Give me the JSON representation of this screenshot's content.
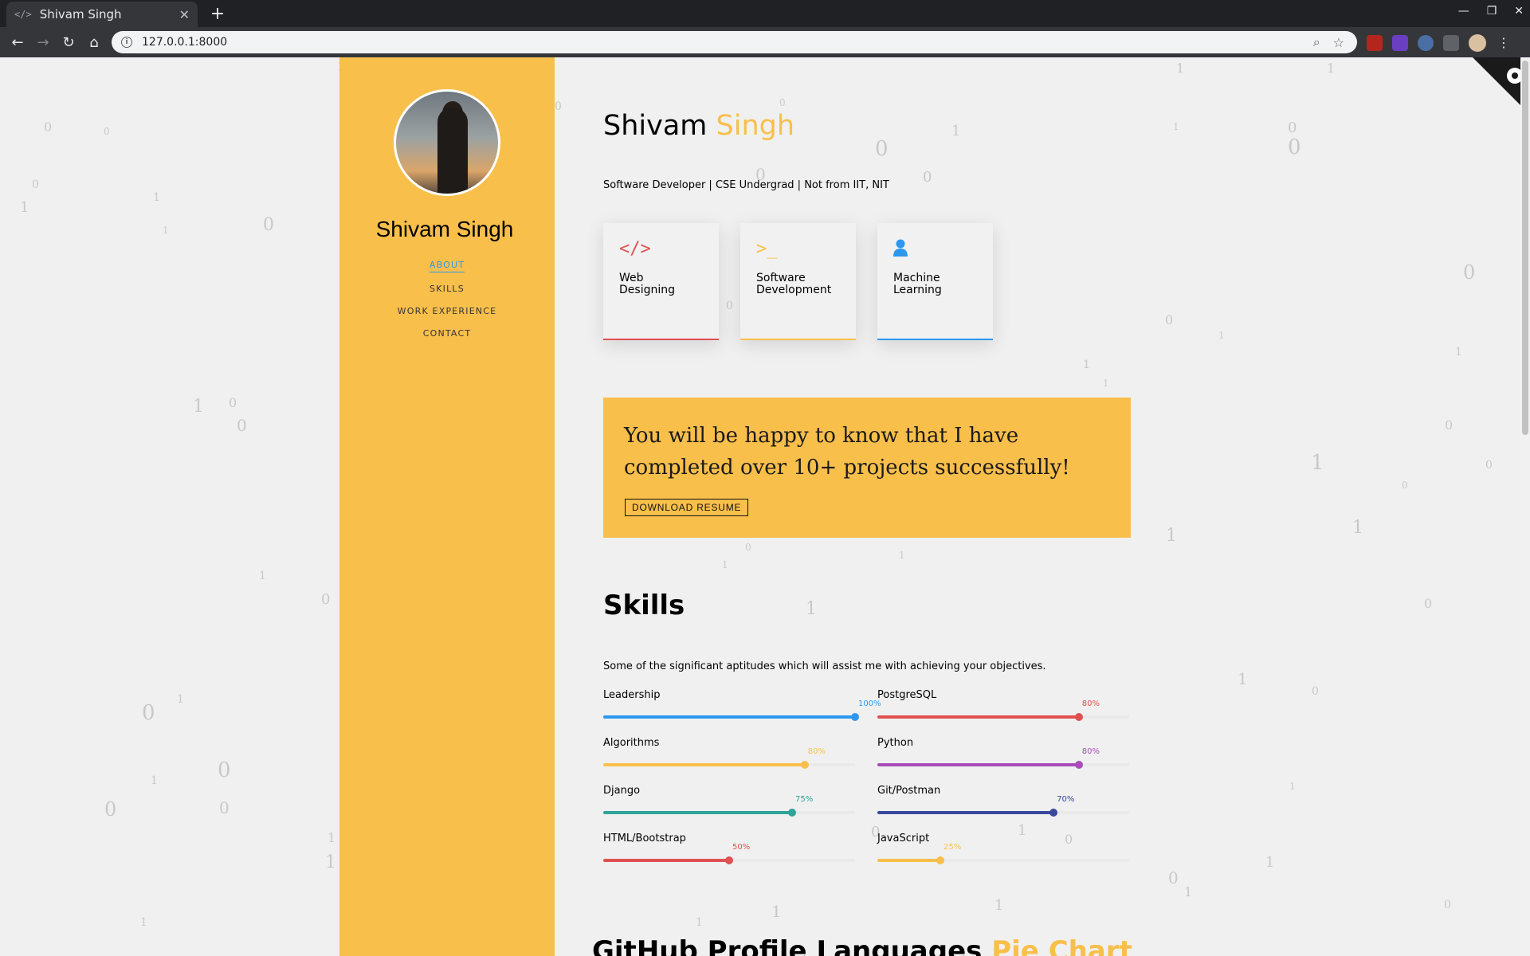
{
  "browser": {
    "tab_title": "Shivam Singh",
    "tab_favicon": "</>",
    "url": "127.0.0.1:8000"
  },
  "sidebar": {
    "name": "Shivam Singh",
    "nav": [
      "ABOUT",
      "SKILLS",
      "WORK EXPERIENCE",
      "CONTACT"
    ],
    "active": "ABOUT"
  },
  "header": {
    "first": "Shivam",
    "last": "Singh",
    "tagline": "Software Developer | CSE Undergrad | Not from IIT, NIT"
  },
  "services": [
    {
      "icon": "code-icon",
      "line1": "Web",
      "line2": "Designing",
      "color": "#e15050"
    },
    {
      "icon": "terminal-icon",
      "line1": "Software",
      "line2": "Development",
      "color": "#f9bf4b"
    },
    {
      "icon": "user-icon",
      "line1": "Machine",
      "line2": "Learning",
      "color": "#2c98f0"
    }
  ],
  "banner": {
    "text": "You will be happy to know that I have completed over 10+ projects successfully!",
    "button": "DOWNLOAD RESUME"
  },
  "skills": {
    "title": "Skills",
    "desc": "Some of the significant aptitudes which will assist me with achieving your objectives.",
    "items": [
      {
        "name": "Leadership",
        "value": 100,
        "color": "#2c98f0"
      },
      {
        "name": "PostgreSQL",
        "value": 80,
        "color": "#e15050"
      },
      {
        "name": "Algorithms",
        "value": 80,
        "color": "#f9bf4b"
      },
      {
        "name": "Python",
        "value": 80,
        "color": "#a84cb8"
      },
      {
        "name": "Django",
        "value": 75,
        "color": "#2fa499"
      },
      {
        "name": "Git/Postman",
        "value": 70,
        "color": "#39489d"
      },
      {
        "name": "HTML/Bootstrap",
        "value": 50,
        "color": "#e15050"
      },
      {
        "name": "JavaScript",
        "value": 25,
        "color": "#f9bf4b"
      }
    ]
  },
  "github": {
    "title_main": "GitHub Profile Languages",
    "title_accent": "Pie Chart"
  }
}
